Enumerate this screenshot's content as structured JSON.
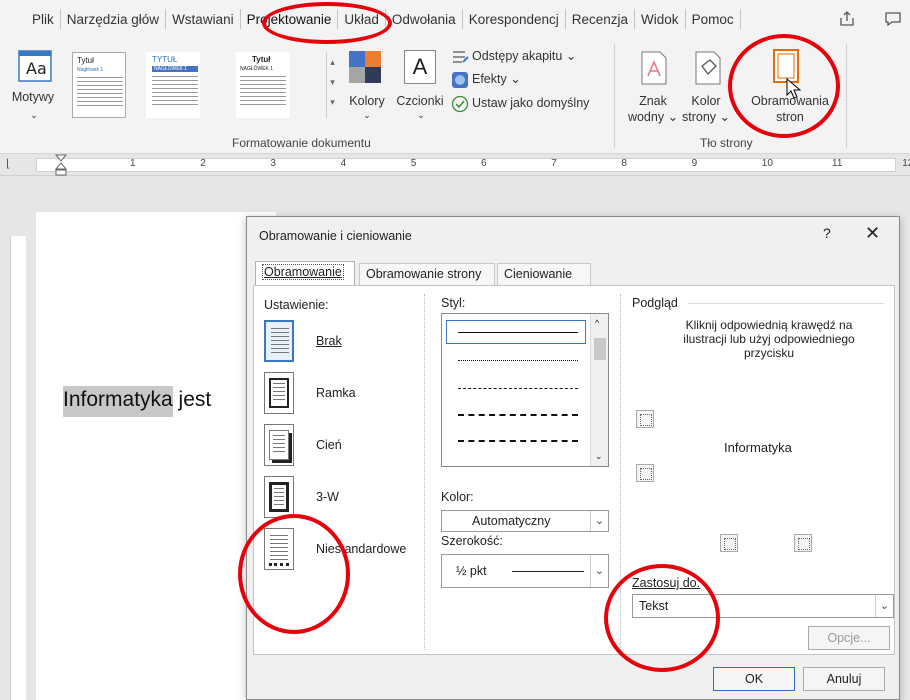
{
  "ribbon": {
    "tabs": [
      "Plik",
      "Narzędzia głów",
      "Wstawiani",
      "Projektowanie",
      "Układ",
      "Odwołania",
      "Korespondencj",
      "Recenzja",
      "Widok",
      "Pomoc"
    ],
    "themes_label": "Motywy",
    "style_thumbs": [
      {
        "title": "Tytuł",
        "heading": "Nagłówek 1"
      },
      {
        "title": "TYTUŁ",
        "heading": "NAGŁÓWEK 1"
      },
      {
        "title": "Tytuł",
        "heading": "NAGŁÓWEK 1"
      }
    ],
    "colors_label": "Kolory",
    "fonts_label": "Czcionki",
    "paragraph_spacing": "Odstępy akapitu",
    "effects": "Efekty",
    "set_default": "Ustaw jako domyślny",
    "group_formatting": "Formatowanie dokumentu",
    "watermark_line1": "Znak",
    "watermark_line2": "wodny",
    "page_color_line1": "Kolor",
    "page_color_line2": "strony",
    "page_borders_line1": "Obramowania",
    "page_borders_line2": "stron",
    "group_background": "Tło strony"
  },
  "ruler": {
    "numbers": [
      "1",
      "2",
      "3",
      "4",
      "5",
      "6",
      "7",
      "8",
      "9",
      "10",
      "11",
      "12"
    ]
  },
  "document": {
    "highlight_word": "Informatyka",
    "rest": " jest"
  },
  "dialog": {
    "title": "Obramowanie i cieniowanie",
    "help": "?",
    "close": "✕",
    "tabs": [
      "Obramowanie",
      "Obramowanie strony",
      "Cieniowanie"
    ],
    "setting_label": "Ustawienie:",
    "settings": [
      "Brak",
      "Ramka",
      "Cień",
      "3-W",
      "Niestandardowe"
    ],
    "style_label": "Styl:",
    "color_label": "Kolor:",
    "color_value": "Automatyczny",
    "width_label": "Szerokość:",
    "width_value": "½ pkt",
    "preview_label": "Podgląd",
    "preview_hint": "Kliknij odpowiednią krawędź na ilustracji lub użyj odpowiedniego przycisku",
    "preview_text": "Informatyka",
    "apply_label": "Zastosuj do:",
    "apply_value": "Tekst",
    "options_button": "Opcje...",
    "ok_button": "OK",
    "cancel_button": "Anuluj"
  },
  "colors": {
    "accent": "#3b78c4",
    "annotation": "#e8000b",
    "page_border_icon": "#e46c0a"
  }
}
